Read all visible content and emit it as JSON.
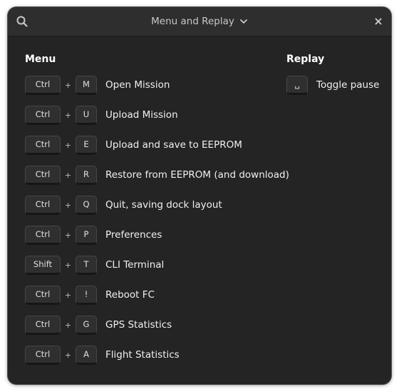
{
  "window": {
    "title": "Menu and Replay"
  },
  "menu": {
    "heading": "Menu",
    "shortcuts": [
      {
        "modifier": "Ctrl",
        "plus": "+",
        "key": "M",
        "action": "Open Mission"
      },
      {
        "modifier": "Ctrl",
        "plus": "+",
        "key": "U",
        "action": "Upload Mission"
      },
      {
        "modifier": "Ctrl",
        "plus": "+",
        "key": "E",
        "action": "Upload and save to EEPROM"
      },
      {
        "modifier": "Ctrl",
        "plus": "+",
        "key": "R",
        "action": "Restore from EEPROM (and download)"
      },
      {
        "modifier": "Ctrl",
        "plus": "+",
        "key": "Q",
        "action": "Quit, saving dock layout"
      },
      {
        "modifier": "Ctrl",
        "plus": "+",
        "key": "P",
        "action": "Preferences"
      },
      {
        "modifier": "Shift",
        "plus": "+",
        "key": "T",
        "action": "CLI Terminal"
      },
      {
        "modifier": "Ctrl",
        "plus": "+",
        "key": "!",
        "action": "Reboot FC"
      },
      {
        "modifier": "Ctrl",
        "plus": "+",
        "key": "G",
        "action": "GPS Statistics"
      },
      {
        "modifier": "Ctrl",
        "plus": "+",
        "key": "A",
        "action": "Flight Statistics"
      }
    ]
  },
  "replay": {
    "heading": "Replay",
    "shortcuts": [
      {
        "key": "␣",
        "action": "Toggle pause"
      }
    ]
  },
  "icons": {
    "search": "search-icon",
    "dropdown": "chevron-down-icon",
    "close": "close-icon"
  }
}
